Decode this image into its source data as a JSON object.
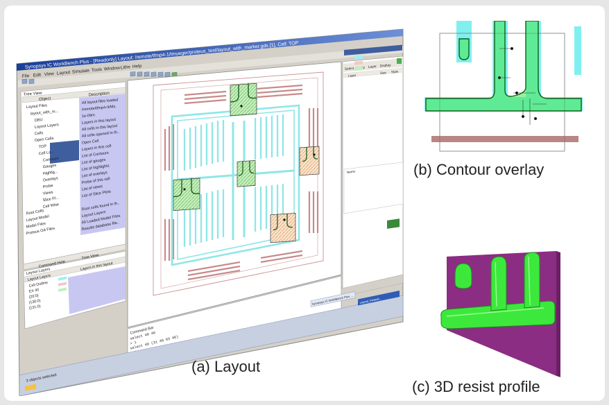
{
  "captions": {
    "layout": "(a) Layout",
    "contour": "(b) Contour overlay",
    "resist": "(c) 3D resist profile"
  },
  "app": {
    "title": "Synopsys IC WorkBench Plus - [Readonly] Layout: /remote/tfmp4-1/tmueger/proteus_test/layout_with_marker.gds [1], Cell: TOP",
    "menu": [
      "File",
      "Edit",
      "View",
      "Layout",
      "Simulate",
      "Tools",
      "Window",
      "Lithe",
      "Help"
    ],
    "tree_panel_title": "Tree View",
    "tree_columns": [
      "Object",
      "Description"
    ],
    "tree_items": [
      {
        "label": "Layout Files",
        "desc": "All layout files loaded"
      },
      {
        "label": "layout_with_m...",
        "desc": "/remote/tfmp4-/t/Ms."
      },
      {
        "label": "DBU",
        "desc": "1e-09m"
      },
      {
        "label": "Layout Layers",
        "desc": "Layers in this layout"
      },
      {
        "label": "Cells",
        "desc": "All cells in this layout"
      },
      {
        "label": "Open Cells",
        "desc": "All cells opened in th.."
      },
      {
        "label": "TOP",
        "desc": "Open Cell"
      },
      {
        "label": "Cell La...",
        "desc": "Layers in this cell"
      },
      {
        "label": "Contours",
        "desc": "List of Contours"
      },
      {
        "label": "Gauges",
        "desc": "List of gauges"
      },
      {
        "label": "Highlig...",
        "desc": "List of highlights"
      },
      {
        "label": "Overlays",
        "desc": "List of overlays"
      },
      {
        "label": "Probe",
        "desc": "Probe of this cell"
      },
      {
        "label": "Views",
        "desc": "List of views"
      },
      {
        "label": "Slice Pl...",
        "desc": "List of Slice Plots"
      },
      {
        "label": "Cell Wise",
        "desc": ""
      },
      {
        "label": "Root Cells",
        "desc": "Root cells found in th.."
      },
      {
        "label": "Layout Model",
        "desc": "Layout Layers"
      },
      {
        "label": "Model Files",
        "desc": "All Loaded Model Files"
      },
      {
        "label": "Proteus OA Files",
        "desc": "Results database file.."
      }
    ],
    "panel_tabs": [
      "Command Help",
      "Tree View"
    ],
    "layers_panel_title": "Layout Layers",
    "layers_columns": [
      "Layout Layers",
      "Layers in this layout"
    ],
    "layers": [
      "Cell Outline",
      "EX 40",
      "(20:0)",
      "(130:0)",
      "(131:0)"
    ],
    "command_label": "Command Bar",
    "command_lines": [
      "select 40 40",
      "> 1",
      "select 40 (31 40 63 40)",
      "> 1"
    ],
    "right_panel_tabs": [
      "Select",
      "Apply",
      "Layer",
      "Display"
    ],
    "right_columns": [
      "Layer",
      "",
      "Size",
      "Style"
    ],
    "properties_title": "Name",
    "status_text": "3 objects selected",
    "taskbar_items": [
      "Synopsys IC WorkBench Plus ...",
      "Layout_Fewest..."
    ]
  }
}
